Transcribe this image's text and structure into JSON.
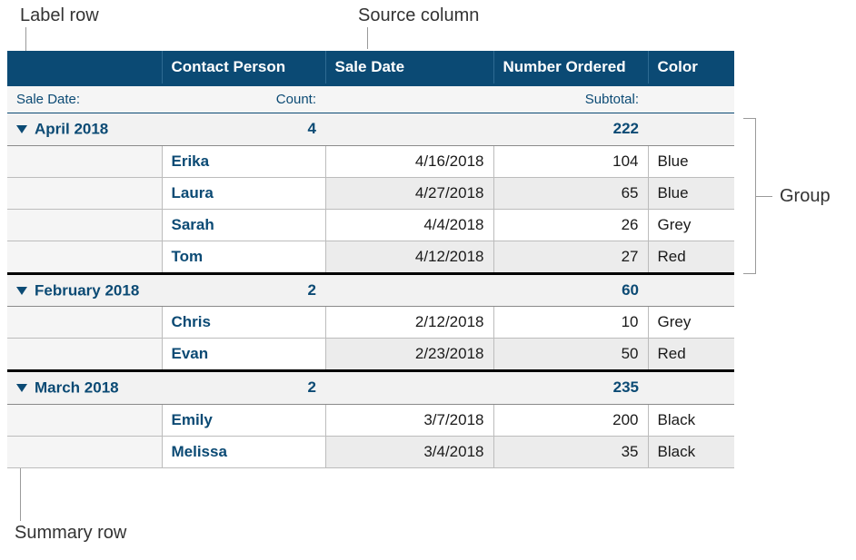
{
  "callouts": {
    "label_row": "Label row",
    "source_column": "Source column",
    "summary_row": "Summary row",
    "group": "Group"
  },
  "columns": {
    "group": "",
    "contact": "Contact Person",
    "date": "Sale Date",
    "num": "Number Ordered",
    "color": "Color"
  },
  "label_row": {
    "group": "Sale Date:",
    "contact": "Count:",
    "num": "Subtotal:"
  },
  "groups": [
    {
      "name": "April 2018",
      "count": "4",
      "subtotal": "222",
      "rows": [
        {
          "contact": "Erika",
          "date": "4/16/2018",
          "num": "104",
          "color": "Blue"
        },
        {
          "contact": "Laura",
          "date": "4/27/2018",
          "num": "65",
          "color": "Blue"
        },
        {
          "contact": "Sarah",
          "date": "4/4/2018",
          "num": "26",
          "color": "Grey"
        },
        {
          "contact": "Tom",
          "date": "4/12/2018",
          "num": "27",
          "color": "Red"
        }
      ]
    },
    {
      "name": "February 2018",
      "count": "2",
      "subtotal": "60",
      "rows": [
        {
          "contact": "Chris",
          "date": "2/12/2018",
          "num": "10",
          "color": "Grey"
        },
        {
          "contact": "Evan",
          "date": "2/23/2018",
          "num": "50",
          "color": "Red"
        }
      ]
    },
    {
      "name": "March 2018",
      "count": "2",
      "subtotal": "235",
      "rows": [
        {
          "contact": "Emily",
          "date": "3/7/2018",
          "num": "200",
          "color": "Black"
        },
        {
          "contact": "Melissa",
          "date": "3/4/2018",
          "num": "35",
          "color": "Black"
        }
      ]
    }
  ]
}
